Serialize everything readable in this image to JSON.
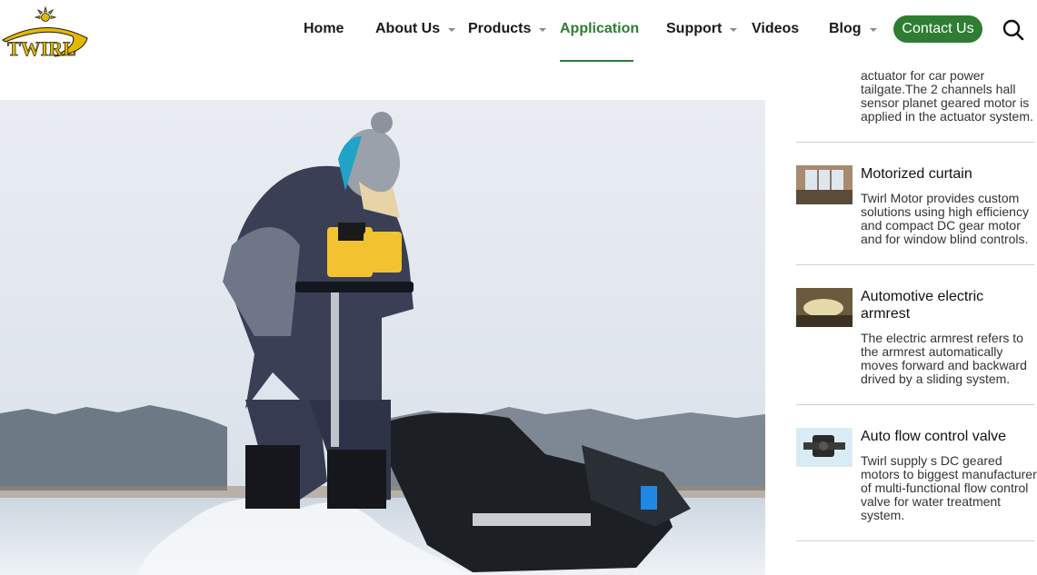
{
  "brand": {
    "logo_text": "TWIRL"
  },
  "nav": {
    "items": [
      {
        "label": "Home",
        "has_caret": false
      },
      {
        "label": "About Us",
        "has_caret": true
      },
      {
        "label": "Products",
        "has_caret": true
      },
      {
        "label": "Application",
        "has_caret": false,
        "active": true
      },
      {
        "label": "Support",
        "has_caret": true
      },
      {
        "label": "Videos",
        "has_caret": false
      },
      {
        "label": "Blog",
        "has_caret": true
      }
    ],
    "contact_label": "Contact Us",
    "active_color": "#2e7d32"
  },
  "sidebar": {
    "top_desc": "actuator for car power tailgate.The 2 channels hall sensor planet geared motor is applied in the actuator system.",
    "items": [
      {
        "title": "Motorized curtain",
        "desc": "Twirl Motor provides custom solutions using high efficiency and compact DC gear motor and for window blind controls.",
        "thumb_icon": "window-room-thumbnail"
      },
      {
        "title": "Automotive electric armrest",
        "desc": "The electric armrest refers to the armrest automatically moves forward and backward drived by a sliding system.",
        "thumb_icon": "car-armrest-thumbnail"
      },
      {
        "title": "Auto flow control valve",
        "desc": "Twirl supply s DC geared motors to biggest manufacturer of multi-functional flow control valve for water treatment system.",
        "thumb_icon": "flow-valve-thumbnail"
      }
    ]
  }
}
